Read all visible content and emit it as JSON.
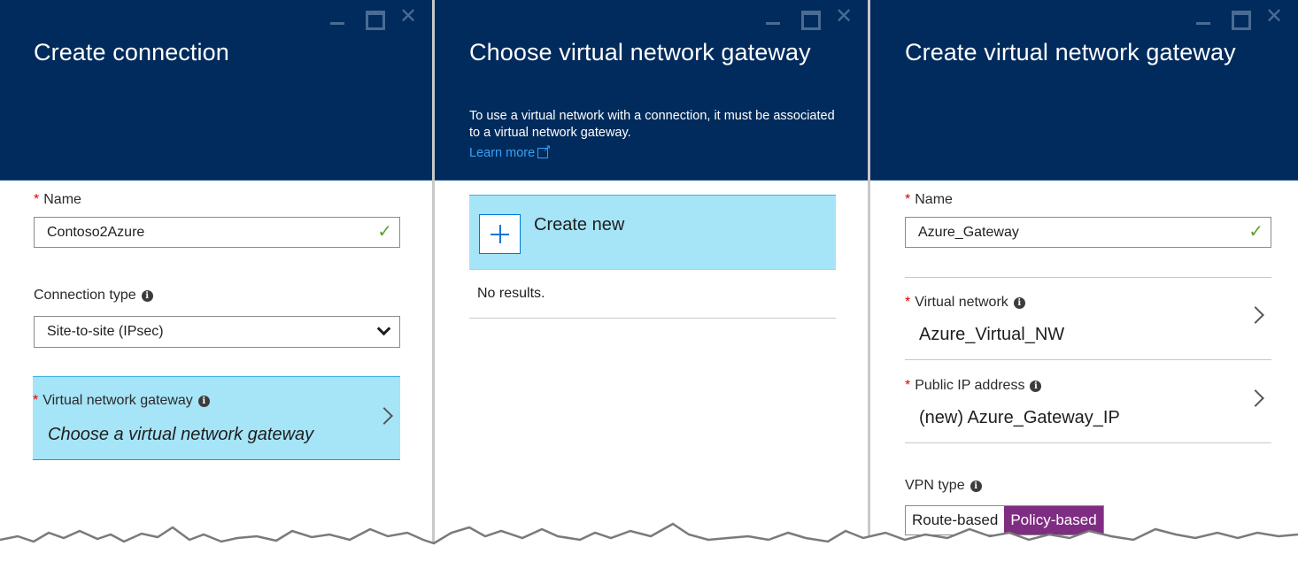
{
  "window_controls": {
    "minimize_glyph": "_",
    "maximize_glyph": "□",
    "close_glyph": "✕"
  },
  "create_connection": {
    "title": "Create connection",
    "name_label": "Name",
    "name_value": "Contoso2Azure",
    "connection_type_label": "Connection type",
    "connection_type_value": "Site-to-site (IPsec)",
    "gateway_label": "Virtual network gateway",
    "gateway_placeholder": "Choose a virtual network gateway"
  },
  "choose_gateway": {
    "title": "Choose virtual network gateway",
    "description": "To use a virtual network with a connection, it must be associated to a virtual network gateway.",
    "learn_more": "Learn more",
    "create_new_label": "Create new",
    "no_results": "No results."
  },
  "create_gateway": {
    "title": "Create virtual network gateway",
    "name_label": "Name",
    "name_value": "Azure_Gateway",
    "virtual_network_label": "Virtual network",
    "virtual_network_value": "Azure_Virtual_NW",
    "public_ip_label": "Public IP address",
    "public_ip_value": "(new) Azure_Gateway_IP",
    "vpn_type_label": "VPN type",
    "vpn_type_options": [
      "Route-based",
      "Policy-based"
    ],
    "vpn_type_selected": "Policy-based"
  },
  "colors": {
    "header_bg": "#002b5c",
    "highlight_bg": "#a6e4f7",
    "required": "#e00000",
    "link": "#3aa0f3",
    "valid_check": "#5aa32d",
    "toggle_active": "#7f2d82"
  }
}
